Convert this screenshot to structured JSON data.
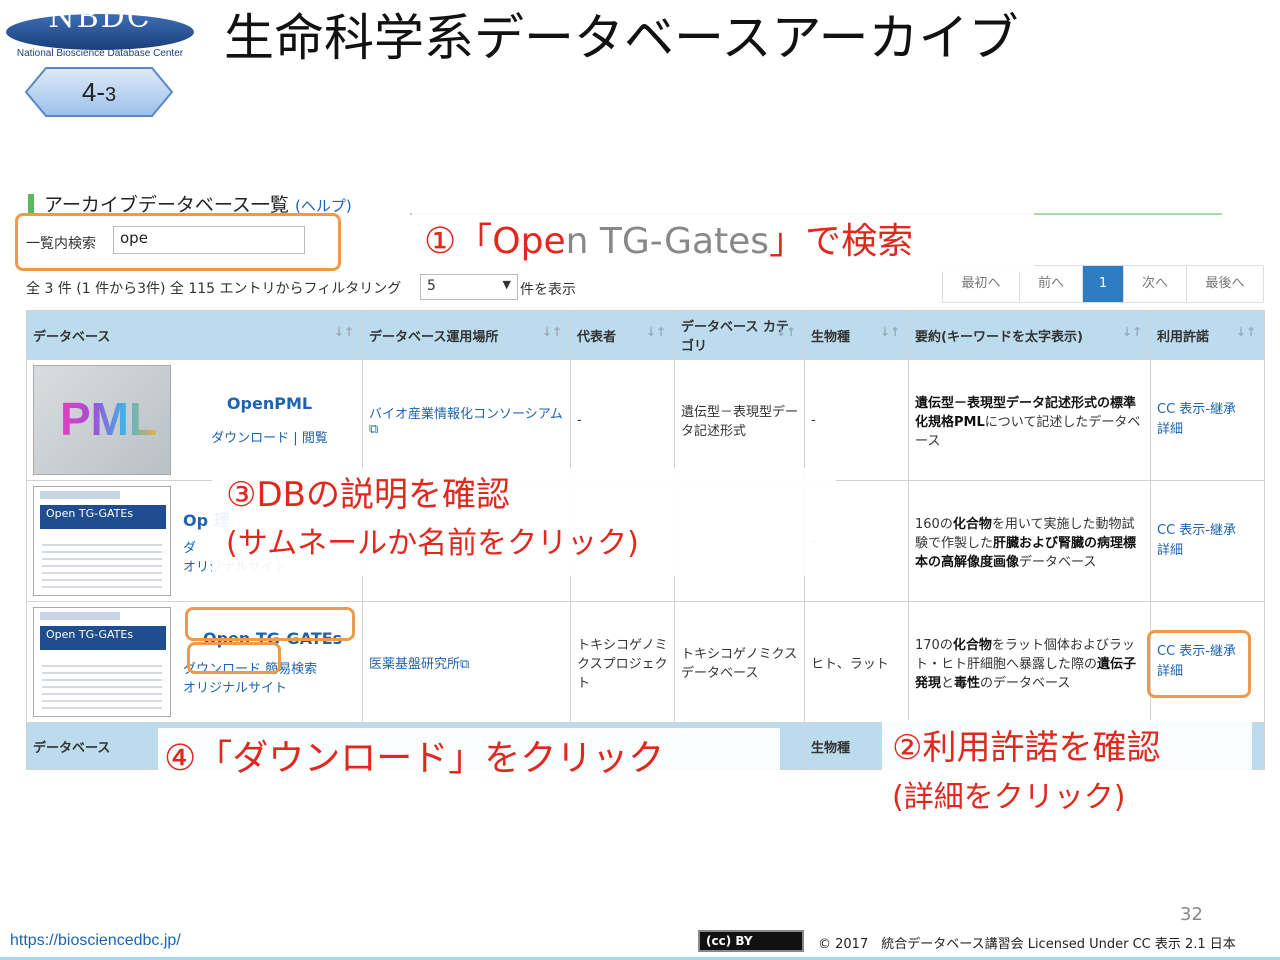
{
  "header": {
    "logo_text": "NBDC",
    "logo_sub": "National Bioscience Database Center",
    "section_major": "4-",
    "section_minor": "3",
    "title": "生命科学系データベースアーカイブ"
  },
  "archive": {
    "heading": "アーカイブデータベース一覧",
    "help_link": "(ヘルプ)",
    "search_label": "一覧内検索",
    "search_value": "ope",
    "filter_info": "全 3 件 (1 件から3件) 全 115 エントリからフィルタリング",
    "page_size": "5",
    "page_size_suffix": "件を表示",
    "pager": [
      "最初へ",
      "前へ",
      "1",
      "次へ",
      "最後へ"
    ],
    "columns": [
      "データベース",
      "データベース運用場所",
      "代表者",
      "データベース カテゴリ",
      "生物種",
      "要約(キーワードを太字表示)",
      "利用許諾"
    ],
    "footer_columns": [
      "データベース",
      "生物種"
    ],
    "rows": [
      {
        "thumb": "PML",
        "name": "OpenPML",
        "link1": "ダウンロード",
        "sep": " | ",
        "link2": "閲覧",
        "link3": "",
        "site": "バイオ産業情報化コンソーシアム",
        "rep": "-",
        "category": "遺伝型－表現型データ記述形式",
        "species": "-",
        "summary_b1": "遺伝型－表現型データ記述形式の標準化規格PML",
        "summary_t1": "について記述したデータベース",
        "summary_b2": "",
        "summary_t2": "",
        "summary_b3": "",
        "summary_t3": "",
        "license": "CC 表示-継承",
        "detail": "詳細"
      },
      {
        "thumb_title": "Open TG-GATEs",
        "name": "Op 理",
        "link1": "ダ",
        "sep": "",
        "link2": "",
        "link3": "オリジナルサイト",
        "site": "",
        "rep": "",
        "category": "",
        "species": "-",
        "summary_t0": "160の",
        "summary_b1": "化合物",
        "summary_t1": "を用いて実施した動物試験で作製した",
        "summary_b2": "肝臓および腎臓の病理標本の高解像度画像",
        "summary_t2": "データベース",
        "license": "CC 表示-継承",
        "detail": "詳細"
      },
      {
        "thumb_title": "Open TG-GATEs",
        "name": "Open TG-GATEs",
        "link1": "ダウンロード",
        "sep": " ",
        "link2": "簡易検索",
        "link3": "オリジナルサイト",
        "site": "医薬基盤研究所",
        "rep": "トキシコゲノミクスプロジェクト",
        "category": "トキシコゲノミクスデータベース",
        "species": "ヒト、ラット",
        "summary_t0": "170の",
        "summary_b1": "化合物",
        "summary_t1": "をラット個体およびラット・ヒト肝細胞へ暴露した際の",
        "summary_b2": "遺伝子発現",
        "summary_t2": "と",
        "summary_b3": "毒性",
        "summary_t3": "のデータベース",
        "license": "CC 表示-継承",
        "detail": "詳細"
      }
    ]
  },
  "annotations": {
    "a1_main": "①「Ope",
    "a1_grey": "n TG-Gates",
    "a1_end": "」で検索",
    "a2_l1": "②利用許諾を確認",
    "a2_l2": "(詳細をクリック)",
    "a3_l1": "③DBの説明を確認",
    "a3_l2": "(サムネールか名前をクリック)",
    "a4": "④「ダウンロード」をクリック"
  },
  "footer": {
    "page": "32",
    "url": "https://biosciencedbc.jp/",
    "cc_badge": "(cc) BY",
    "license_text": "© 2017　統合データベース講習会 Licensed Under CC 表示 2.1 日本"
  },
  "colors": {
    "annotation_red": "#e0281f",
    "highlight_orange": "#ef9a4a",
    "header_blue": "#bcdcee",
    "link_blue": "#1d63b0",
    "pager_active": "#2e7dc2"
  }
}
